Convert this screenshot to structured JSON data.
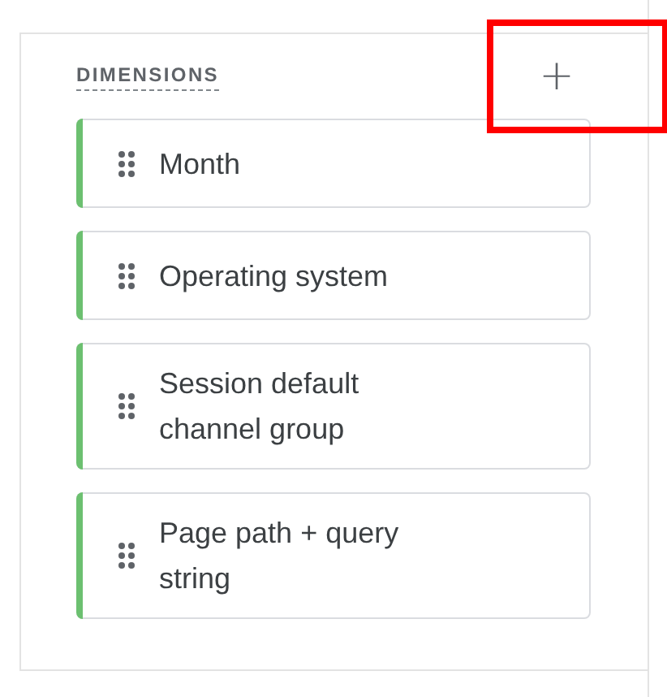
{
  "section": {
    "title": "DIMENSIONS",
    "add_button": {
      "symbol": "+",
      "highlighted": true
    },
    "items": [
      {
        "label": "Month",
        "color": "#6cc070"
      },
      {
        "label": "Operating system",
        "color": "#6cc070"
      },
      {
        "label": "Session default channel group",
        "color": "#6cc070"
      },
      {
        "label": "Page path + query string",
        "color": "#6cc070"
      }
    ]
  }
}
